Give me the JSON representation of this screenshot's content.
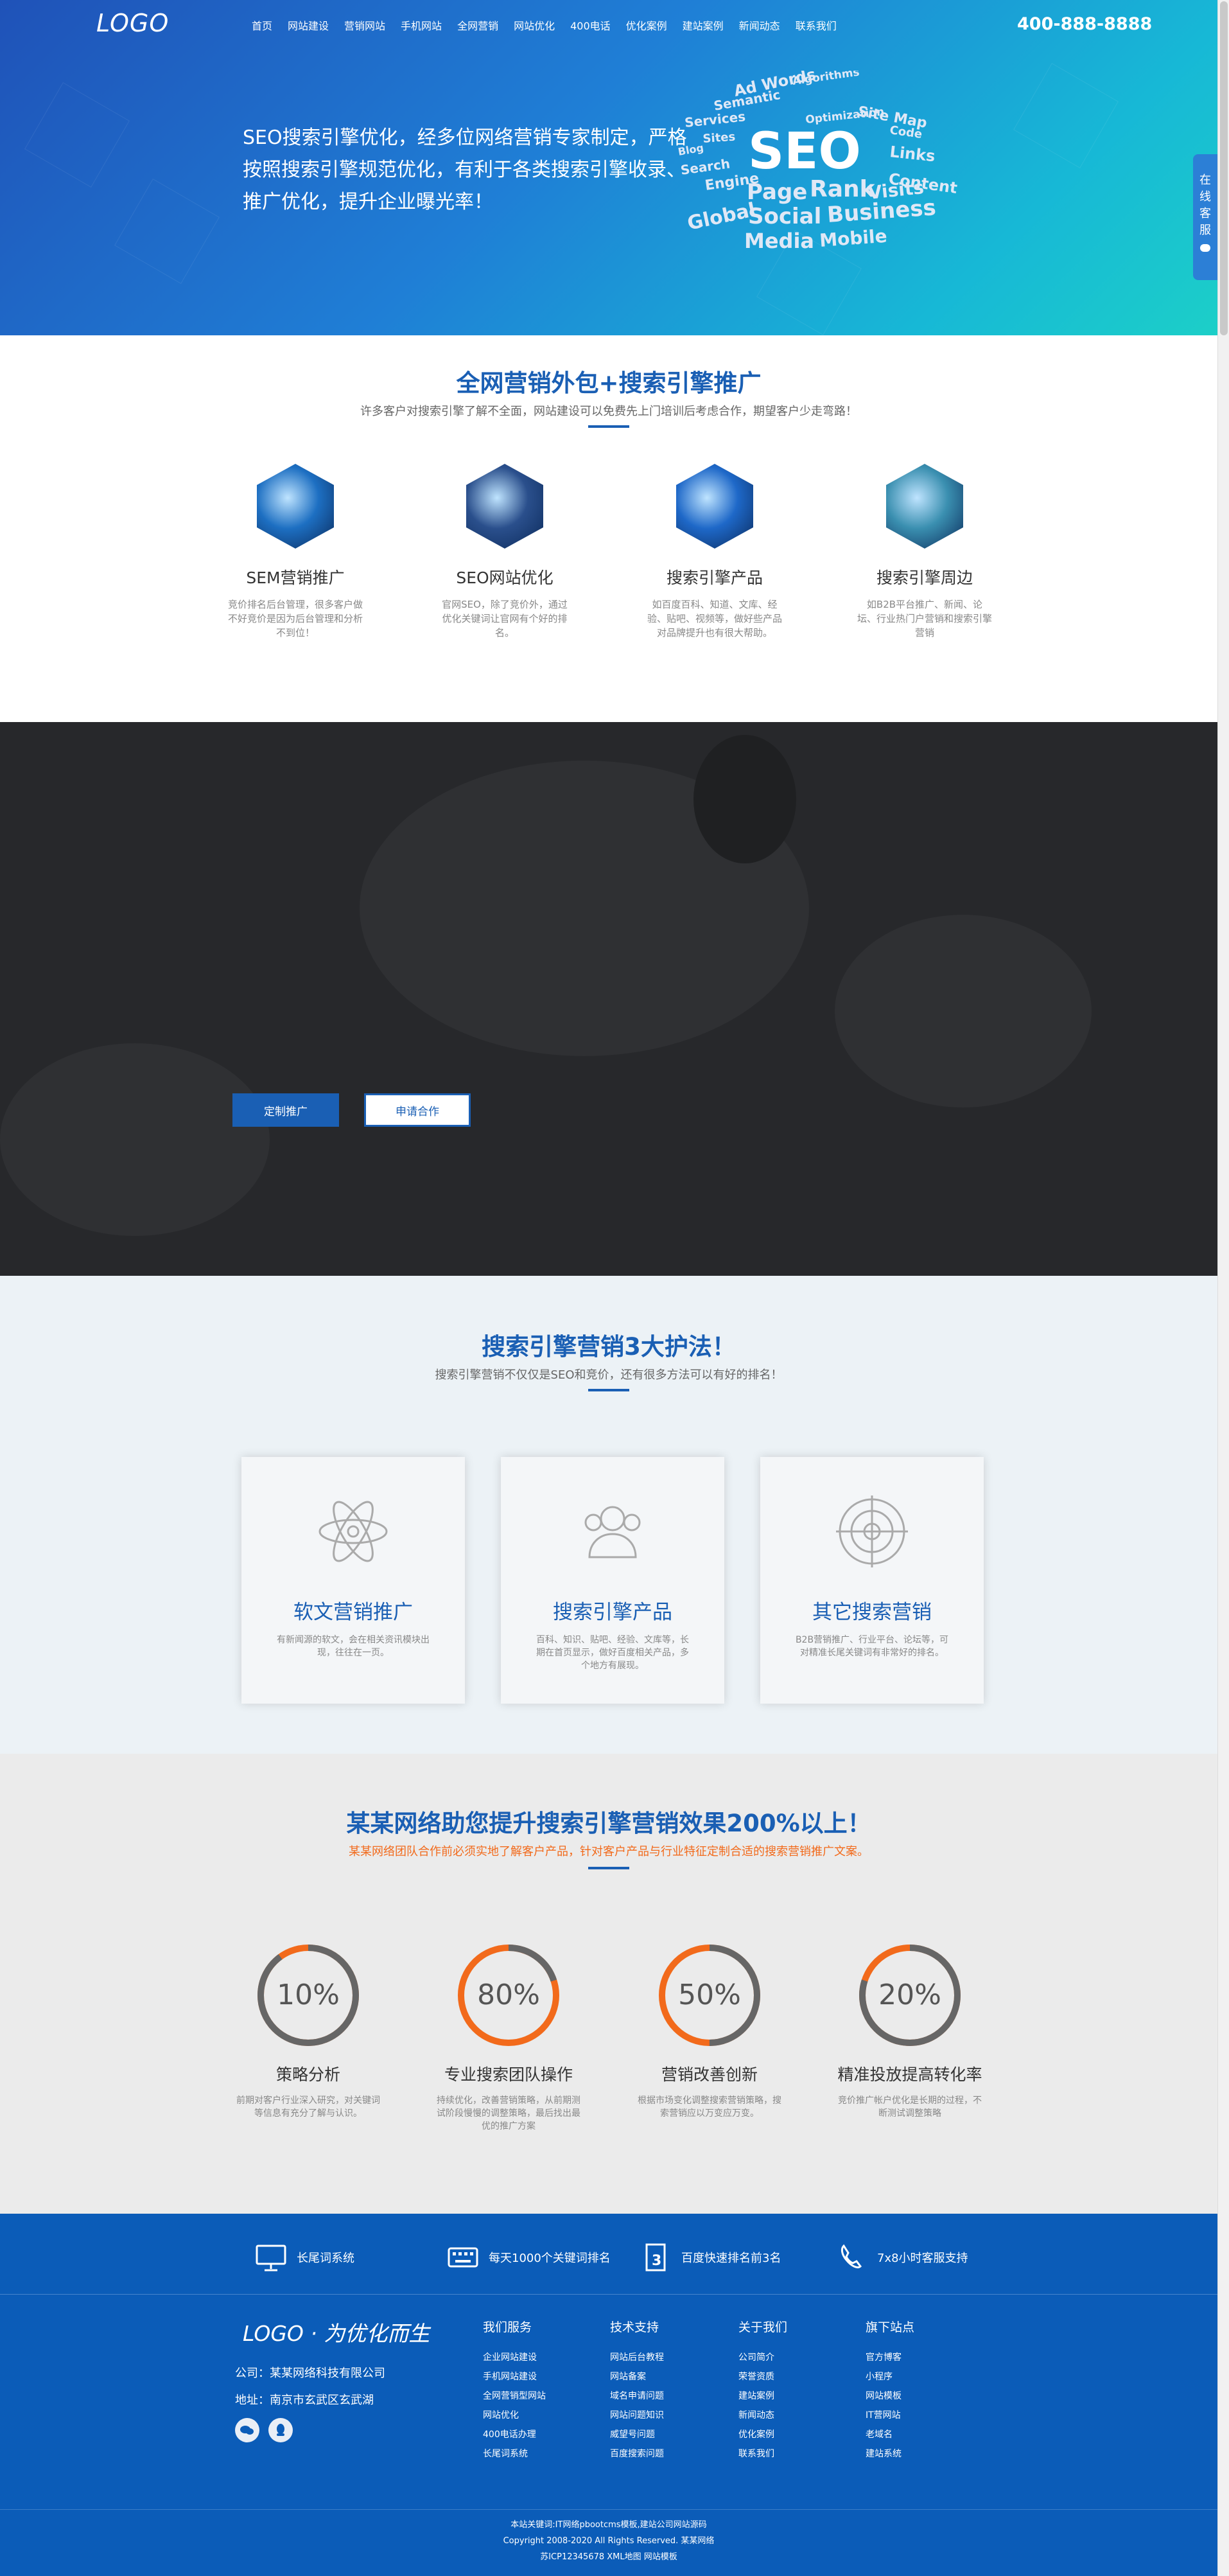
{
  "header": {
    "logo": "LOGO",
    "nav": [
      "首页",
      "网站建设",
      "营销网站",
      "手机网站",
      "全网营销",
      "网站优化",
      "400电话",
      "优化案例",
      "建站案例",
      "新闻动态",
      "联系我们"
    ],
    "phone": "400-888-8888"
  },
  "hero": {
    "text": "SEO搜索引擎优化，经多位网络营销专家制定，严格按照搜索引擎规范优化，有利于各类搜索引擎收录、推广优化，提升企业曝光率！",
    "cloud_words": [
      "Algorithms",
      "Ad Words",
      "Semantic",
      "Site Map",
      "Services",
      "Optimization",
      "Code",
      "Sites",
      "Blog",
      "SEO",
      "Links",
      "Search",
      "Content",
      "Engine",
      "Page",
      "Rank",
      "Visits",
      "Global",
      "Social",
      "Business",
      "Media",
      "Mobile"
    ],
    "side_consult": "在线客服"
  },
  "section_promo": {
    "title": "全网营销外包+搜索引擎推广",
    "subtitle": "许多客户对搜索引擎了解不全面，网站建设可以免费先上门培训后考虑合作，期望客户少走弯路！",
    "cards": [
      {
        "title": "SEM营销推广",
        "desc": "竞价排名后台管理，很多客户做不好竞价是因为后台管理和分析不到位！",
        "color": "#1d6fc2"
      },
      {
        "title": "SEO网站优化",
        "desc": "官网SEO，除了竞价外，通过优化关键词让官网有个好的排名。",
        "color": "#2a4f8c"
      },
      {
        "title": "搜索引擎产品",
        "desc": "如百度百科、知道、文库、经验、贴吧、视频等，做好些产品对品牌提升也有很大帮助。",
        "color": "#1e68c8"
      },
      {
        "title": "搜索引擎周边",
        "desc": "如B2B平台推广、新闻、论坛、行业热门户营销和搜索引擎营销",
        "color": "#3a8fb0"
      }
    ]
  },
  "section_cta": {
    "btn_primary": "定制推广",
    "btn_secondary": "申请合作"
  },
  "section_methods": {
    "title": "搜索引擎营销3大护法！",
    "subtitle": "搜索引擎营销不仅仅是SEO和竞价，还有很多方法可以有好的排名！",
    "boxes": [
      {
        "icon": "atom-icon",
        "title": "软文营销推广",
        "desc": "有新闻源的软文，会在相关资讯模块出现，往往在一页。"
      },
      {
        "icon": "team-icon",
        "title": "搜索引擎产品",
        "desc": "百科、知识、贴吧、经验、文库等，长期在首页显示，做好百度相关产品，多个地方有展现。"
      },
      {
        "icon": "target-icon",
        "title": "其它搜索营销",
        "desc": "B2B营销推广、行业平台、论坛等，可对精准长尾关键词有非常好的排名。"
      }
    ]
  },
  "section_stats": {
    "title": "某某网络助您提升搜索引擎营销效果200%以上！",
    "subtitle": "某某网络团队合作前必须实地了解客户产品，针对客户产品与行业特征定制合适的搜索营销推广文案。",
    "accent_color": "#f26a1b",
    "stats": [
      {
        "value": "10%",
        "progress": 0.1,
        "title": "策略分析",
        "desc": "前期对客户行业深入研究，对关键词等信息有充分了解与认识。"
      },
      {
        "value": "80%",
        "progress": 0.8,
        "title": "专业搜索团队操作",
        "desc": "持续优化，改善营销策略，从前期测试阶段慢慢的调整策略，最后找出最优的推广方案"
      },
      {
        "value": "50%",
        "progress": 0.5,
        "title": "营销改善创新",
        "desc": "根据市场变化调整搜索营销策略，搜索营销应以万变应万变。"
      },
      {
        "value": "20%",
        "progress": 0.2,
        "title": "精准投放提高转化率",
        "desc": "竞价推广帐户优化是长期的过程，不断测试调整策略"
      }
    ]
  },
  "footer": {
    "features": [
      {
        "icon": "monitor-icon",
        "label": "长尾词系统"
      },
      {
        "icon": "keyboard-icon",
        "label": "每天1000个关键词排名"
      },
      {
        "icon": "rank-3-icon",
        "label": "百度快速排名前3名"
      },
      {
        "icon": "phone-icon",
        "label": "7x8小时客服支持"
      }
    ],
    "logo": "LOGO · 为优化而生",
    "company": "公司：某某网络科技有限公司",
    "address": "地址：南京市玄武区玄武湖",
    "columns": [
      {
        "title": "我们服务",
        "links": [
          "企业网站建设",
          "手机网站建设",
          "全网营销型网站",
          "网站优化",
          "400电话办理",
          "长尾词系统"
        ]
      },
      {
        "title": "技术支持",
        "links": [
          "网站后台教程",
          "网站备案",
          "域名申请问题",
          "网站问题知识",
          "威望号问题",
          "百度搜索问题"
        ]
      },
      {
        "title": "关于我们",
        "links": [
          "公司简介",
          "荣誉资质",
          "建站案例",
          "新闻动态",
          "优化案例",
          "联系我们"
        ]
      },
      {
        "title": "旗下站点",
        "links": [
          "官方博客",
          "小程序",
          "网站模板",
          "IT营网站",
          "老域名",
          "建站系统"
        ]
      }
    ],
    "copyright": [
      "本站关键词:IT网络pbootcms模板,建站公司网站源码",
      "Copyright 2008-2020 All Rights Reserved. 某某网络",
      "苏ICP12345678  XML地图  网站模板"
    ]
  }
}
